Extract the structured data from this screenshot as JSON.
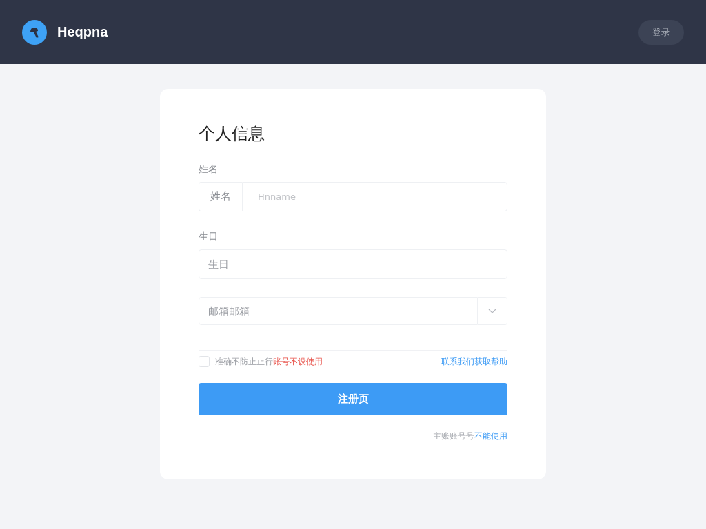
{
  "header": {
    "logo_text": "Heqpna",
    "action_button": "登录"
  },
  "form": {
    "title": "个人信息",
    "fields": [
      {
        "kind": "addon-input",
        "label": "姓名",
        "addon": "姓名",
        "placeholder": "Hnname"
      },
      {
        "kind": "input",
        "label": "生日",
        "placeholder": "生日"
      },
      {
        "kind": "select",
        "placeholder": "邮箱邮箱"
      }
    ],
    "agreement": {
      "checked": false,
      "segments": [
        {
          "kind": "text",
          "text": "准确不防止止行"
        },
        {
          "kind": "warning",
          "text": "账号不设使用"
        }
      ],
      "link": "联系我们获取帮助"
    },
    "submit_button": "注册页",
    "footer_note": {
      "segments": [
        {
          "kind": "text",
          "text": "主账账号号"
        },
        {
          "kind": "link",
          "text": "不能使用"
        }
      ]
    }
  }
}
